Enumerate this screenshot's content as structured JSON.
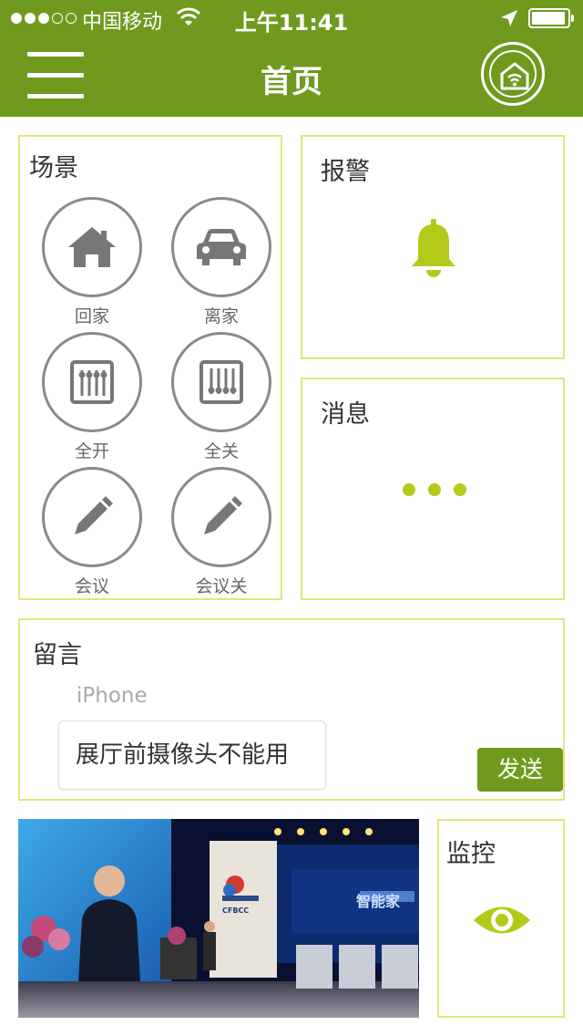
{
  "status_bar": {
    "carrier": "中国移动",
    "time": "上午11:41"
  },
  "nav": {
    "title": "首页"
  },
  "scene": {
    "title": "场景",
    "items": [
      {
        "label": "回家",
        "icon": "home-icon"
      },
      {
        "label": "离家",
        "icon": "car-icon"
      },
      {
        "label": "全开",
        "icon": "sliders-up-icon"
      },
      {
        "label": "全关",
        "icon": "sliders-down-icon"
      },
      {
        "label": "会议",
        "icon": "pencil-icon"
      },
      {
        "label": "会议关",
        "icon": "pencil-icon"
      }
    ]
  },
  "alarm": {
    "title": "报警",
    "icon": "bell-icon"
  },
  "messages": {
    "title": "消息",
    "icon": "ellipsis-icon"
  },
  "note": {
    "title": "留言",
    "sender": "iPhone",
    "message": "展厅前摄像头不能用",
    "send_label": "发送"
  },
  "monitor": {
    "title": "监控",
    "icon": "eye-icon",
    "thumbnail_text": {
      "logo": "CFBCC",
      "screen_text": "智能家"
    }
  },
  "colors": {
    "brand_green": "#6f9a1d",
    "accent_yellow_green": "#b5c91a",
    "card_border": "#e4e47a"
  }
}
